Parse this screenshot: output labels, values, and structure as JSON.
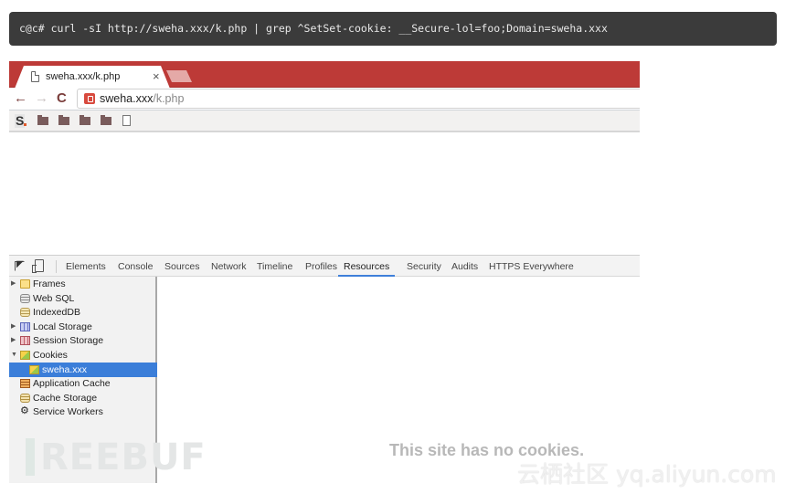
{
  "terminal": {
    "command": "c@c# curl -sI http://sweha.xxx/k.php | grep ^SetSet-cookie: __Secure-lol=foo;Domain=sweha.xxx"
  },
  "browser": {
    "tab": {
      "title": "sweha.xxx/k.php",
      "icon": "page-icon",
      "close_glyph": "×"
    },
    "new_tab_icon": "new-tab-icon",
    "nav": {
      "back_glyph": "←",
      "forward_glyph": "→",
      "reload_glyph": "C"
    },
    "omnibox": {
      "security_icon": "not-secure-lock-icon",
      "host": "sweha.xxx",
      "path": "/k.php"
    },
    "bookmarks": {
      "items": [
        {
          "type": "site",
          "label": "S",
          "icon": "s-logo-icon"
        },
        {
          "type": "folder",
          "icon": "folder-icon"
        },
        {
          "type": "folder",
          "icon": "folder-icon"
        },
        {
          "type": "folder",
          "icon": "folder-icon"
        },
        {
          "type": "folder",
          "icon": "folder-icon"
        },
        {
          "type": "page",
          "icon": "page-icon"
        }
      ]
    },
    "accent_color": "#bd3a37"
  },
  "devtools": {
    "toolbar_icons": [
      "inspect-element-icon",
      "device-mode-icon"
    ],
    "tabs": [
      {
        "label": "Elements",
        "active": false
      },
      {
        "label": "Console",
        "active": false
      },
      {
        "label": "Sources",
        "active": false
      },
      {
        "label": "Network",
        "active": false
      },
      {
        "label": "Timeline",
        "active": false
      },
      {
        "label": "Profiles",
        "active": false
      },
      {
        "label": "Resources",
        "active": true
      },
      {
        "label": "Security",
        "active": false
      },
      {
        "label": "Audits",
        "active": false
      },
      {
        "label": "HTTPS Everywhere",
        "active": false
      }
    ],
    "sidebar": [
      {
        "label": "Frames",
        "icon": "folder-icon",
        "expandable": true,
        "expanded": false,
        "indent": 0
      },
      {
        "label": "Web SQL",
        "icon": "database-icon",
        "expandable": false,
        "indent": 0
      },
      {
        "label": "IndexedDB",
        "icon": "indexeddb-icon",
        "expandable": false,
        "indent": 0
      },
      {
        "label": "Local Storage",
        "icon": "local-storage-icon",
        "expandable": true,
        "expanded": false,
        "indent": 0
      },
      {
        "label": "Session Storage",
        "icon": "session-storage-icon",
        "expandable": true,
        "expanded": false,
        "indent": 0
      },
      {
        "label": "Cookies",
        "icon": "cookie-icon",
        "expandable": true,
        "expanded": true,
        "indent": 0
      },
      {
        "label": "sweha.xxx",
        "icon": "cookie-icon",
        "expandable": false,
        "indent": 1,
        "selected": true
      },
      {
        "label": "Application Cache",
        "icon": "application-cache-icon",
        "expandable": false,
        "indent": 0
      },
      {
        "label": "Cache Storage",
        "icon": "cache-storage-icon",
        "expandable": false,
        "indent": 0
      },
      {
        "label": "Service Workers",
        "icon": "gear-icon",
        "expandable": false,
        "indent": 0
      }
    ],
    "empty_message": "This site has no cookies.",
    "selection_color": "#3b7ed9"
  },
  "watermarks": {
    "left": "REEBUF",
    "right": "云栖社区 yq.aliyun.com"
  }
}
